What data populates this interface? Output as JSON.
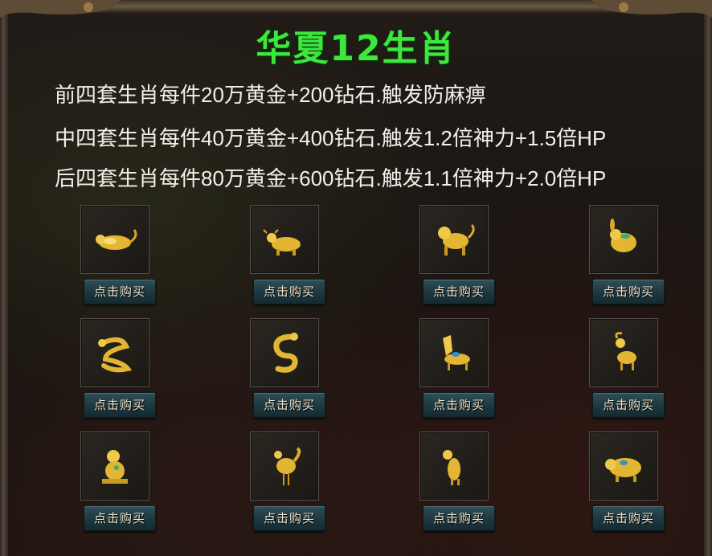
{
  "title": "华夏12生肖",
  "description_lines": [
    "前四套生肖每件20万黄金+200钻石.触发防麻痹",
    "中四套生肖每件40万黄金+400钻石.触发1.2倍神力+1.5倍HP",
    "后四套生肖每件80万黄金+600钻石.触发1.1倍神力+2.0倍HP"
  ],
  "buy_label": "点击购买",
  "colors": {
    "title": "#3ee63e",
    "gold": "#e2b632",
    "button": "#1d3840"
  },
  "items": [
    {
      "icon": "rat-icon"
    },
    {
      "icon": "ox-icon"
    },
    {
      "icon": "tiger-icon"
    },
    {
      "icon": "rabbit-icon"
    },
    {
      "icon": "dragon-icon"
    },
    {
      "icon": "snake-icon"
    },
    {
      "icon": "horse-icon"
    },
    {
      "icon": "goat-icon"
    },
    {
      "icon": "monkey-icon"
    },
    {
      "icon": "rooster-icon"
    },
    {
      "icon": "dog-icon"
    },
    {
      "icon": "pig-icon"
    }
  ]
}
